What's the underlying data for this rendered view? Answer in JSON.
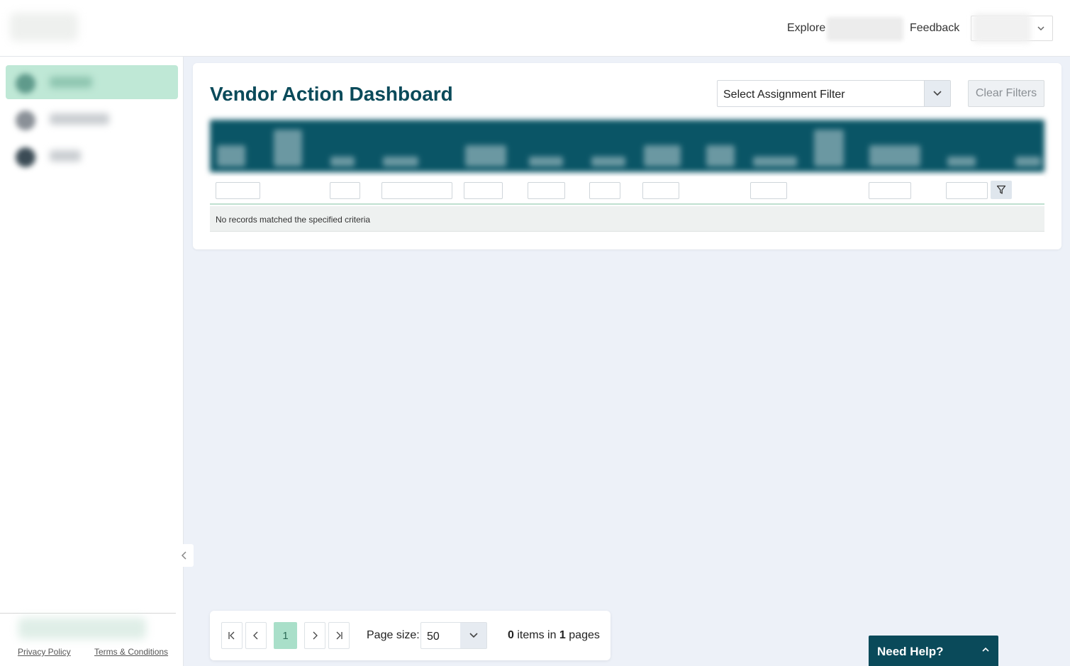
{
  "header": {
    "explore_label": "Explore",
    "feedback_label": "Feedback"
  },
  "dashboard": {
    "title": "Vendor Action Dashboard",
    "assignment_filter": "Select Assignment Filter",
    "clear_filters_label": "Clear Filters",
    "no_records_text": "No records matched the specified criteria"
  },
  "pager": {
    "current_page": "1",
    "page_size_label": "Page size:",
    "page_size_value": "50",
    "item_count": "0",
    "items_in_text": " items in ",
    "page_count": "1",
    "pages_text": " pages"
  },
  "footer": {
    "privacy_label": "Privacy Policy",
    "terms_label": "Terms & Conditions"
  },
  "help": {
    "label": "Need Help?"
  },
  "colors": {
    "brand_dark": "#0a4a5a",
    "accent_green": "#bfe8d6",
    "page_bg": "#edf1f8"
  }
}
